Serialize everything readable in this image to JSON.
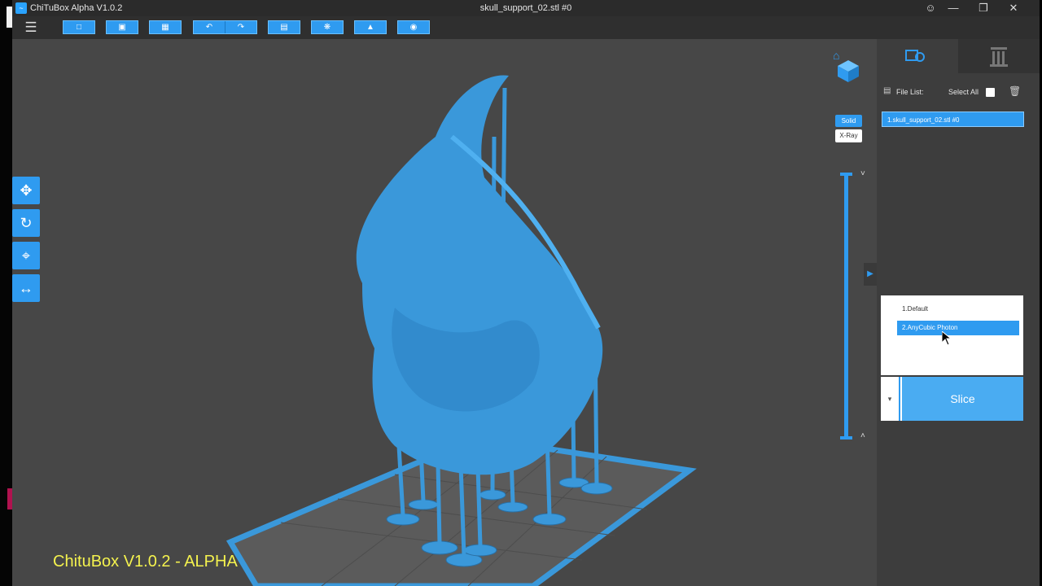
{
  "window": {
    "app_name": "ChiTuBox Alpha V1.0.2",
    "file_title": "skull_support_02.stl #0",
    "logo_glyph": "~"
  },
  "window_controls": {
    "user": "☺",
    "minimize": "—",
    "restore": "❐",
    "close": "✕"
  },
  "toolbar": {
    "menu_glyph": "☰",
    "icons": [
      "open-file-icon",
      "save-icon",
      "import-icon",
      "undo-icon",
      "redo-icon",
      "mirror-icon",
      "supports-icon",
      "hollow-icon",
      "settings-icon"
    ]
  },
  "view": {
    "solid_label": "Solid",
    "xray_label": "X-Ray",
    "home_glyph": "⌂",
    "slider_up": "˅",
    "slider_down": "˄"
  },
  "left_tools": [
    {
      "name": "move-tool",
      "glyph": "✥"
    },
    {
      "name": "rotate-tool",
      "glyph": "↻"
    },
    {
      "name": "scale-tool",
      "glyph": "⌖"
    },
    {
      "name": "mirror-tool",
      "glyph": "↔"
    }
  ],
  "panel": {
    "file_list_label": "File List:",
    "select_all_label": "Select All",
    "trash_glyph": "🗑",
    "files": [
      "1.skull_support_02.stl #0"
    ],
    "expand_glyph": "▶"
  },
  "profiles": {
    "items": [
      "1.Default",
      "2.AnyCubic Photon"
    ],
    "selected": 1
  },
  "slice": {
    "label": "Slice",
    "dropdown_glyph": "▾"
  },
  "watermark": "ChituBox V1.0.2 - ALPHA",
  "colors": {
    "accent": "#2f9bf0",
    "model": "#3a98da",
    "plate": "#5a5a5a",
    "watermark": "#f4f24e"
  }
}
